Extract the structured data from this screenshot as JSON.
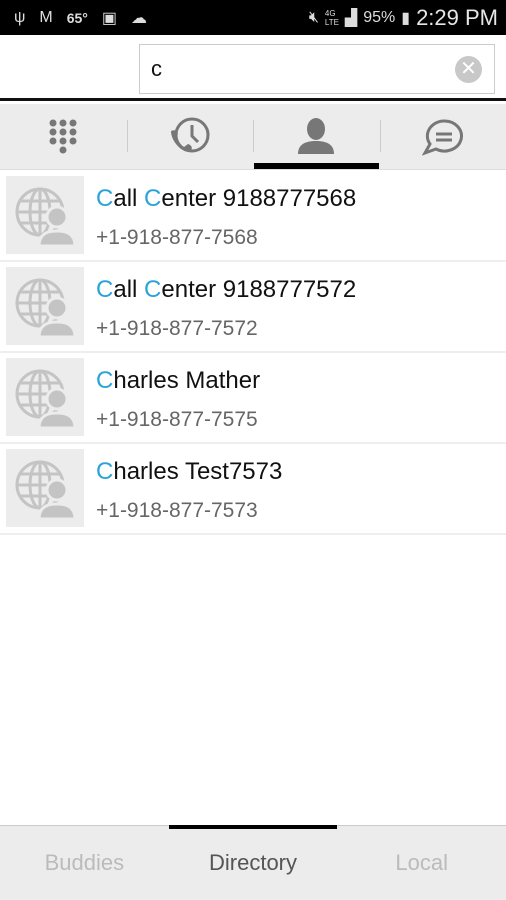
{
  "status_bar": {
    "temperature": "65°",
    "battery": "95%",
    "time": "2:29 PM",
    "network": "4G LTE",
    "icons": [
      "usb-icon",
      "gmail-icon",
      "image-icon",
      "sync-icon",
      "mute-icon",
      "signal-icon",
      "battery-charging-icon"
    ]
  },
  "search": {
    "value": "c",
    "clear_icon": "clear-icon"
  },
  "tabs": [
    {
      "icon": "dialpad-icon"
    },
    {
      "icon": "call-history-icon"
    },
    {
      "icon": "contacts-icon",
      "active": true
    },
    {
      "icon": "chat-icon"
    }
  ],
  "contacts": [
    {
      "name_parts": [
        {
          "text": "C",
          "hl": true
        },
        {
          "text": "all ",
          "hl": false
        },
        {
          "text": "C",
          "hl": true
        },
        {
          "text": "enter 9188777568",
          "hl": false
        }
      ],
      "phone": "+1-918-877-7568"
    },
    {
      "name_parts": [
        {
          "text": "C",
          "hl": true
        },
        {
          "text": "all ",
          "hl": false
        },
        {
          "text": "C",
          "hl": true
        },
        {
          "text": "enter 9188777572",
          "hl": false
        }
      ],
      "phone": "+1-918-877-7572"
    },
    {
      "name_parts": [
        {
          "text": "C",
          "hl": true
        },
        {
          "text": "harles Mather",
          "hl": false
        }
      ],
      "phone": "+1-918-877-7575"
    },
    {
      "name_parts": [
        {
          "text": "C",
          "hl": true
        },
        {
          "text": "harles Test7573",
          "hl": false
        }
      ],
      "phone": "+1-918-877-7573"
    }
  ],
  "bottom_tabs": [
    {
      "label": "Buddies"
    },
    {
      "label": "Directory",
      "active": true
    },
    {
      "label": "Local"
    }
  ],
  "colors": {
    "highlight": "#29a3d8",
    "active_indicator": "#000000"
  }
}
